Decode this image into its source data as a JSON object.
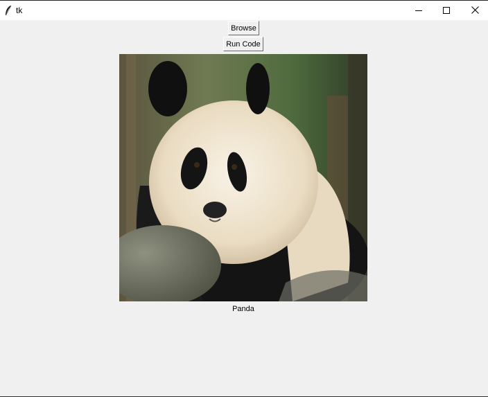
{
  "window": {
    "title": "tk",
    "app_icon": "feather-icon",
    "controls": [
      "minimize-icon",
      "maximize-icon",
      "close-icon"
    ]
  },
  "buttons": {
    "browse_label": "Browse",
    "run_label": "Run Code"
  },
  "image": {
    "subject": "panda-photo",
    "caption": "Panda"
  }
}
